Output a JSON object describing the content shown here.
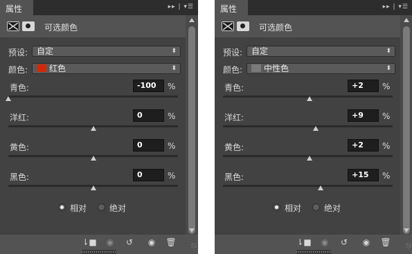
{
  "colors": {
    "panel": "#535353",
    "body": "#424242",
    "red": "#cc2a0f",
    "neutral": "#7a7a7a"
  },
  "panels": [
    {
      "tab": "属性",
      "header_title": "可选颜色",
      "preset_label": "预设:",
      "preset_value": "自定",
      "color_label": "颜色:",
      "color_value": "红色",
      "color_swatch_hex": "#cc2a0f",
      "sliders": [
        {
          "label": "青色:",
          "value": "-100",
          "unit": "%",
          "level": -1.0
        },
        {
          "label": "洋红:",
          "value": "0",
          "unit": "%",
          "level": 0.0
        },
        {
          "label": "黄色:",
          "value": "0",
          "unit": "%",
          "level": 0.0
        },
        {
          "label": "黑色:",
          "value": "0",
          "unit": "%",
          "level": 0.0
        }
      ],
      "methods": [
        {
          "label": "相对",
          "checked": true
        },
        {
          "label": "绝对",
          "checked": false
        }
      ],
      "footer_icons": [
        "clip-to-layer-icon",
        "visibility-toggle-icon",
        "reset-icon",
        "eye-icon",
        "trash-icon"
      ]
    },
    {
      "tab": "属性",
      "header_title": "可选颜色",
      "preset_label": "预设:",
      "preset_value": "自定",
      "color_label": "颜色:",
      "color_value": "中性色",
      "color_swatch_hex": "#7a7a7a",
      "sliders": [
        {
          "label": "青色:",
          "value": "+2",
          "unit": "%",
          "level": 0.02
        },
        {
          "label": "洋红:",
          "value": "+9",
          "unit": "%",
          "level": 0.09
        },
        {
          "label": "黄色:",
          "value": "+2",
          "unit": "%",
          "level": 0.02
        },
        {
          "label": "黑色:",
          "value": "+15",
          "unit": "%",
          "level": 0.15
        }
      ],
      "methods": [
        {
          "label": "相对",
          "checked": true
        },
        {
          "label": "绝对",
          "checked": false
        }
      ],
      "footer_icons": [
        "clip-to-layer-icon",
        "visibility-toggle-icon",
        "reset-icon",
        "eye-icon",
        "trash-icon"
      ]
    }
  ]
}
